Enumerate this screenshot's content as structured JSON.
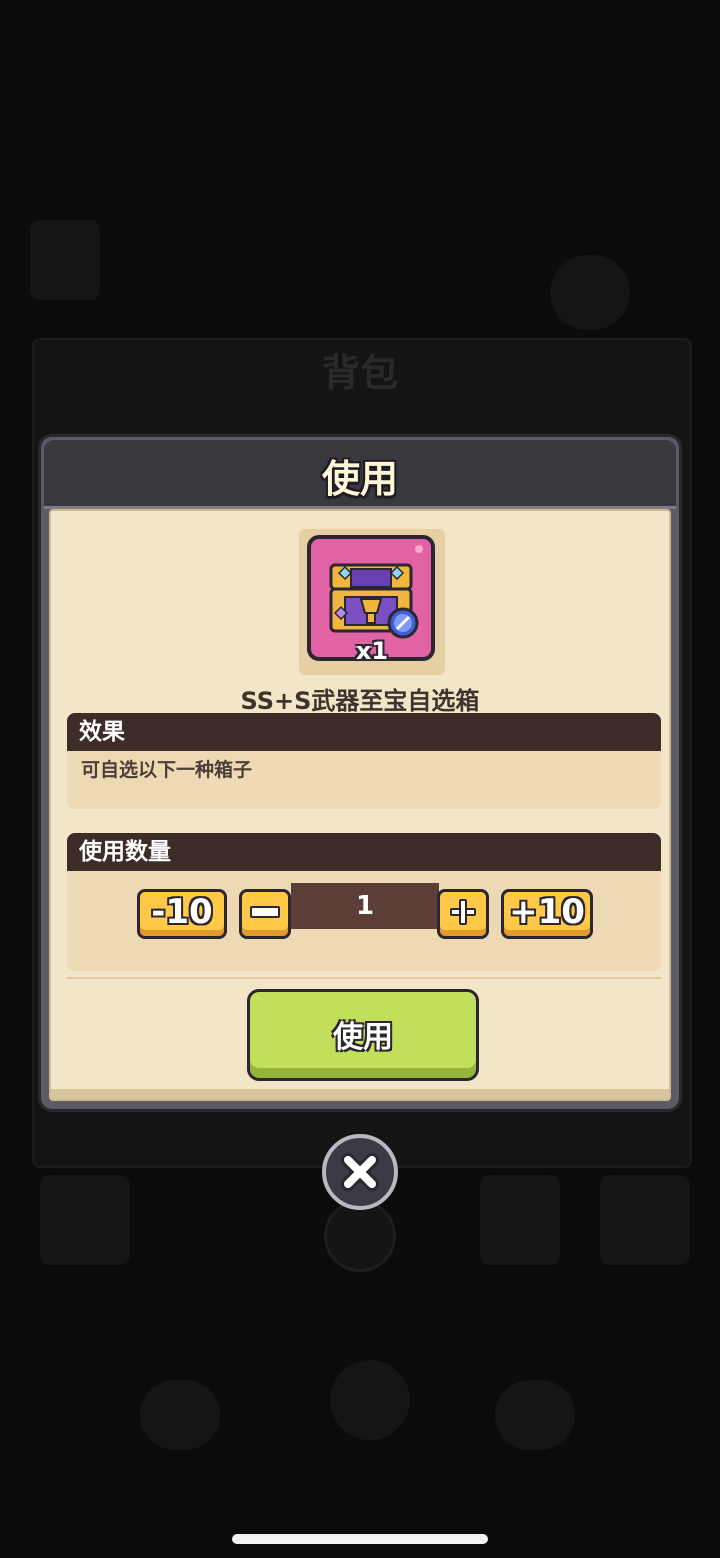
{
  "background": {
    "panel_title": "背包"
  },
  "dialog": {
    "title": "使用",
    "item": {
      "name": "SS+S武器至宝自选箱",
      "count": "x1"
    },
    "effect": {
      "header": "效果",
      "description": "可自选以下一种箱子"
    },
    "quantity": {
      "header": "使用数量",
      "minus10_label": "-10",
      "minus_icon": "minus-icon",
      "value": "1",
      "plus_icon": "plus-icon",
      "plus10_label": "+10"
    },
    "use_button_label": "使用"
  },
  "close_button": {
    "icon": "close-icon"
  },
  "colors": {
    "dialog_frame": "#5d5a63",
    "dialog_body": "#f3e5c7",
    "section_header": "#3c2d28",
    "accent_yellow": "#ffc847",
    "accent_green": "#c2df5b",
    "item_pink": "#e163a5"
  }
}
